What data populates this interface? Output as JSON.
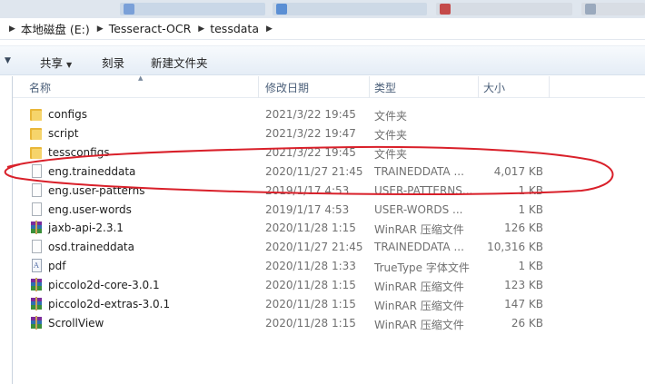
{
  "breadcrumb": {
    "items": [
      "本地磁盘 (E:)",
      "Tesseract-OCR",
      "tessdata"
    ]
  },
  "toolbar": {
    "share_label": "共享",
    "burn_label": "刻录",
    "new_folder_label": "新建文件夹"
  },
  "columns": {
    "name": "名称",
    "modified": "修改日期",
    "type": "类型",
    "size": "大小"
  },
  "files": [
    {
      "name": "configs",
      "modified": "2021/3/22 19:45",
      "type": "文件夹",
      "size": "",
      "icon": "folder-icon"
    },
    {
      "name": "script",
      "modified": "2021/3/22 19:47",
      "type": "文件夹",
      "size": "",
      "icon": "folder-icon"
    },
    {
      "name": "tessconfigs",
      "modified": "2021/3/22 19:45",
      "type": "文件夹",
      "size": "",
      "icon": "folder-icon"
    },
    {
      "name": "eng.traineddata",
      "modified": "2020/11/27 21:45",
      "type": "TRAINEDDATA ...",
      "size": "4,017 KB",
      "icon": "document-icon"
    },
    {
      "name": "eng.user-patterns",
      "modified": "2019/1/17 4:53",
      "type": "USER-PATTERNS...",
      "size": "1 KB",
      "icon": "document-icon"
    },
    {
      "name": "eng.user-words",
      "modified": "2019/1/17 4:53",
      "type": "USER-WORDS ...",
      "size": "1 KB",
      "icon": "document-icon"
    },
    {
      "name": "jaxb-api-2.3.1",
      "modified": "2020/11/28 1:15",
      "type": "WinRAR 压缩文件",
      "size": "126 KB",
      "icon": "winrar-icon"
    },
    {
      "name": "osd.traineddata",
      "modified": "2020/11/27 21:45",
      "type": "TRAINEDDATA ...",
      "size": "10,316 KB",
      "icon": "document-icon"
    },
    {
      "name": "pdf",
      "modified": "2020/11/28 1:33",
      "type": "TrueType 字体文件",
      "size": "1 KB",
      "icon": "font-icon"
    },
    {
      "name": "piccolo2d-core-3.0.1",
      "modified": "2020/11/28 1:15",
      "type": "WinRAR 压缩文件",
      "size": "123 KB",
      "icon": "winrar-icon"
    },
    {
      "name": "piccolo2d-extras-3.0.1",
      "modified": "2020/11/28 1:15",
      "type": "WinRAR 压缩文件",
      "size": "147 KB",
      "icon": "winrar-icon"
    },
    {
      "name": "ScrollView",
      "modified": "2020/11/28 1:15",
      "type": "WinRAR 压缩文件",
      "size": "26 KB",
      "icon": "winrar-icon"
    }
  ],
  "annotation": {
    "color": "#d9202a",
    "highlighted_file": "eng.traineddata"
  }
}
